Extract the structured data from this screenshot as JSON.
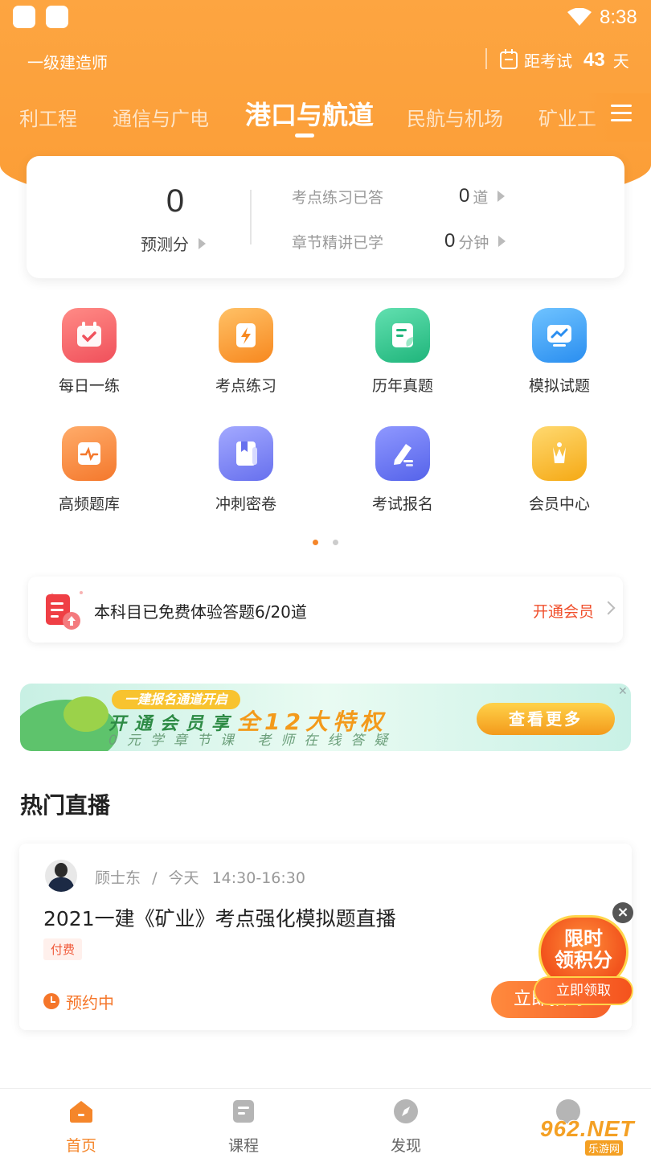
{
  "status_bar": {
    "time": "8:38"
  },
  "header": {
    "exam_name": "一级建造师",
    "countdown_label": "距考试",
    "countdown_days": "43",
    "countdown_unit": "天"
  },
  "subject_tabs": [
    {
      "label": "利工程",
      "active": false
    },
    {
      "label": "通信与广电",
      "active": false
    },
    {
      "label": "港口与航道",
      "active": true
    },
    {
      "label": "民航与机场",
      "active": false
    },
    {
      "label": "矿业工",
      "active": false
    }
  ],
  "score_card": {
    "predict_score": "0",
    "predict_label": "预测分",
    "stats": [
      {
        "label": "考点练习已答",
        "value": "0",
        "unit": "道"
      },
      {
        "label": "章节精讲已学",
        "value": "0",
        "unit": "分钟"
      }
    ]
  },
  "features": [
    {
      "label": "每日一练",
      "icon": "calendar-check-icon",
      "color": "#f45a62"
    },
    {
      "label": "考点练习",
      "icon": "lightning-note-icon",
      "color": "#fa9a32"
    },
    {
      "label": "历年真题",
      "icon": "document-leaf-icon",
      "color": "#2fc78f"
    },
    {
      "label": "模拟试题",
      "icon": "monitor-chart-icon",
      "color": "#2f9cf2"
    },
    {
      "label": "高频题库",
      "icon": "pulse-scroll-icon",
      "color": "#fb8a3a"
    },
    {
      "label": "冲刺密卷",
      "icon": "bookmark-book-icon",
      "color": "#6f7df2"
    },
    {
      "label": "考试报名",
      "icon": "pen-form-icon",
      "color": "#5f6df0"
    },
    {
      "label": "会员中心",
      "icon": "crown-member-icon",
      "color": "#f9b825"
    }
  ],
  "pagination": {
    "pages": 2,
    "active": 0,
    "active_color": "#f5862a",
    "inactive_color": "#cccccc"
  },
  "trial": {
    "text": "本科目已免费体验答题6/20道",
    "link": "开通会员"
  },
  "banner": {
    "tag": "一建报名通道开启",
    "line1_prefix": "开通会员享",
    "line1_highlight": "全12大特权",
    "line2": "0元学章节课 老师在线答疑",
    "button": "查看更多"
  },
  "hot_live": {
    "section_title": "热门直播",
    "teacher": "顾士东",
    "date": "今天",
    "time": "14:30-16:30",
    "title": "2021一建《矿业》考点强化模拟题直播",
    "tag": "付费",
    "status": "预约中",
    "button": "立即预约"
  },
  "promo": {
    "text_line1": "限时",
    "text_line2": "领积分",
    "button": "立即领取"
  },
  "bottom_nav": [
    {
      "label": "首页",
      "icon": "home-icon",
      "active": true
    },
    {
      "label": "课程",
      "icon": "course-icon",
      "active": false
    },
    {
      "label": "发现",
      "icon": "compass-icon",
      "active": false
    }
  ],
  "watermark": {
    "main": "962.NET",
    "sub": "乐游网"
  }
}
